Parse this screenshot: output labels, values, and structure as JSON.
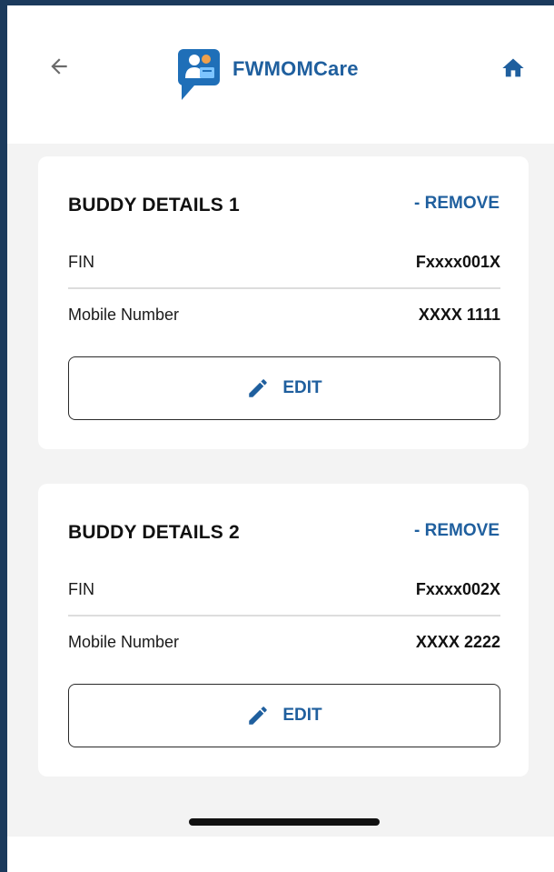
{
  "header": {
    "back_icon": "arrow-left-icon",
    "app_name": "FWMOMCare",
    "logo_icon": "fwmomcare-logo-icon",
    "home_icon": "home-icon"
  },
  "buddies": [
    {
      "title": "BUDDY DETAILS 1",
      "remove_label": "- REMOVE",
      "fin_label": "FIN",
      "fin_value": "Fxxxx001X",
      "mobile_label": "Mobile Number",
      "mobile_value": "XXXX 1111",
      "edit_label": "EDIT"
    },
    {
      "title": "BUDDY DETAILS 2",
      "remove_label": "- REMOVE",
      "fin_label": "FIN",
      "fin_value": "Fxxxx002X",
      "mobile_label": "Mobile Number",
      "mobile_value": "XXXX 2222",
      "edit_label": "EDIT"
    }
  ],
  "colors": {
    "brand": "#1f5f9e",
    "background": "#f3f3f3",
    "card": "#ffffff",
    "frame": "#1b3a5c"
  }
}
